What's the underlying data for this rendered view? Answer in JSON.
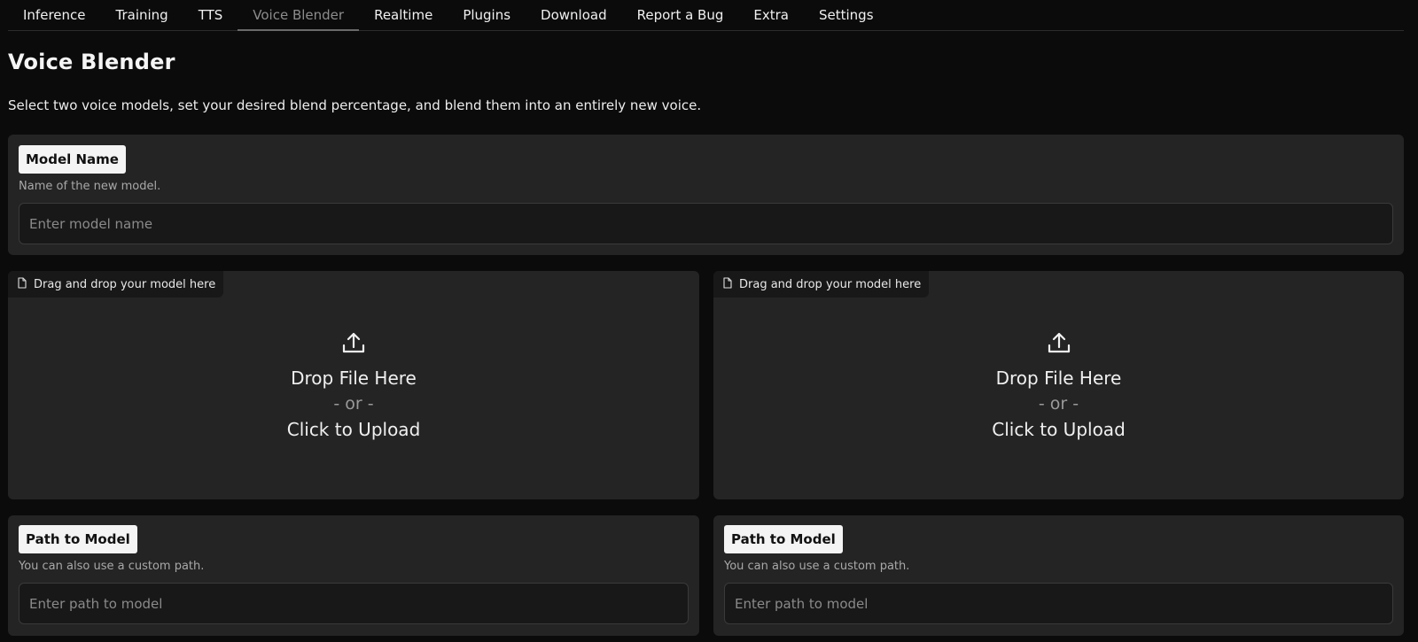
{
  "tabs": [
    {
      "label": "Inference"
    },
    {
      "label": "Training"
    },
    {
      "label": "TTS"
    },
    {
      "label": "Voice Blender"
    },
    {
      "label": "Realtime"
    },
    {
      "label": "Plugins"
    },
    {
      "label": "Download"
    },
    {
      "label": "Report a Bug"
    },
    {
      "label": "Extra"
    },
    {
      "label": "Settings"
    }
  ],
  "active_tab": "Voice Blender",
  "page": {
    "title": "Voice Blender",
    "description": "Select two voice models, set your desired blend percentage, and blend them into an entirely new voice."
  },
  "model_name": {
    "label": "Model Name",
    "info": "Name of the new model.",
    "placeholder": "Enter model name",
    "value": ""
  },
  "dropzones": [
    {
      "tag": "Drag and drop your model here",
      "icon": "file-icon",
      "upload_icon": "upload-icon",
      "drop_text": "Drop File Here",
      "or_text": "- or -",
      "click_text": "Click to Upload"
    },
    {
      "tag": "Drag and drop your model here",
      "icon": "file-icon",
      "upload_icon": "upload-icon",
      "drop_text": "Drop File Here",
      "or_text": "- or -",
      "click_text": "Click to Upload"
    }
  ],
  "path_fields": [
    {
      "label": "Path to Model",
      "info": "You can also use a custom path.",
      "placeholder": "Enter path to model",
      "value": ""
    },
    {
      "label": "Path to Model",
      "info": "You can also use a custom path.",
      "placeholder": "Enter path to model",
      "value": ""
    }
  ],
  "colors": {
    "background": "#0c0b0b",
    "panel": "#242424",
    "input": "#181818",
    "label_badge": "#f4f4f4",
    "active_tab_text": "#8c8c8c"
  }
}
